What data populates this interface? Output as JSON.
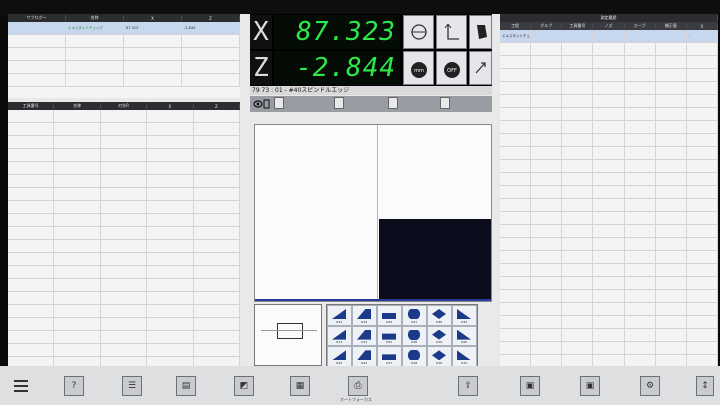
{
  "window": {
    "title": ""
  },
  "left_top_table": {
    "columns": [
      "サブログー",
      "名称",
      "X",
      "Z"
    ],
    "rows": [
      [
        "",
        "エキスタンドチェック",
        "87.323",
        "-2.844"
      ]
    ]
  },
  "left_bottom_table": {
    "columns": [
      "工具番号",
      "名称",
      "刃先R",
      "X",
      "Z"
    ],
    "rows": []
  },
  "readout": {
    "x_axis": "X",
    "x_value": "87.323",
    "z_axis": "Z",
    "z_value": "-2.844",
    "status_line": "79 73 : 01 - #40スピンドルエッジ"
  },
  "right_table": {
    "title": "測定履歴",
    "columns": [
      "工程",
      "グルプ",
      "工具番号",
      "ノズ",
      "カーブ",
      "補正値",
      "X"
    ],
    "rows": [
      [
        "エキスタンドチェック",
        "",
        "",
        "",
        "",
        "",
        "-"
      ]
    ]
  },
  "toolbar_mid": {
    "label": ""
  },
  "tools": [
    "O12",
    "O14",
    "O32",
    "O21",
    "O38",
    "O34",
    "O13",
    "O11",
    "O31",
    "O36",
    "O19",
    "O20",
    "O22",
    "O24",
    "O37",
    "O18",
    "O16",
    "O15"
  ],
  "taskbar": {
    "center_label": "オートフォーカス"
  },
  "colors": {
    "readout_green": "#2ee84a",
    "header_dark": "#2c2d31",
    "workpiece": "#0b0d1c",
    "tool_blue": "#1c3a8a"
  }
}
